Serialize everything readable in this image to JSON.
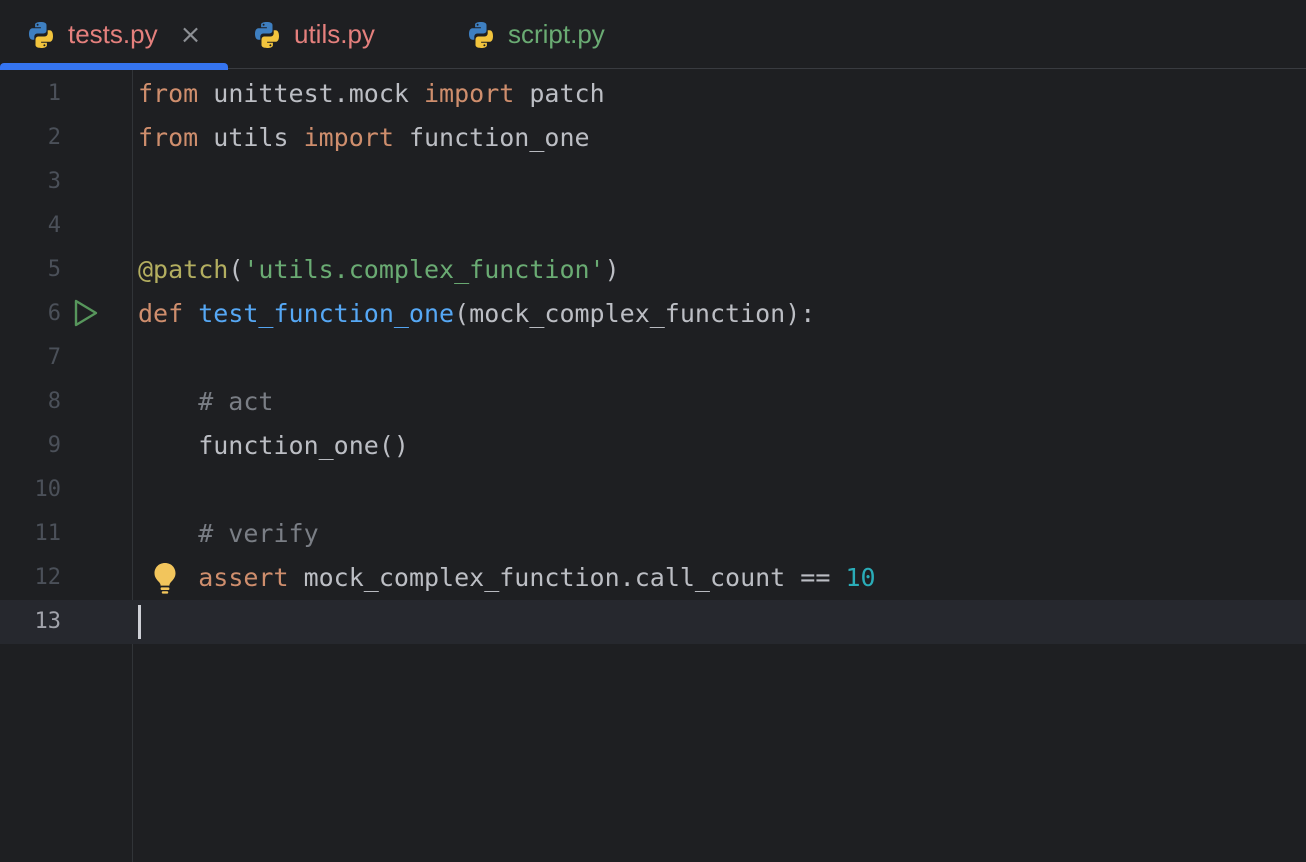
{
  "tabs": [
    {
      "label": "tests.py",
      "color": "#e5807d",
      "active": true,
      "closable": true,
      "close_glyph": "×"
    },
    {
      "label": "utils.py",
      "color": "#e5807d",
      "active": false
    },
    {
      "label": "script.py",
      "color": "#6aab73",
      "active": false
    }
  ],
  "accent_color": "#3574f0",
  "editor": {
    "line_numbers": [
      "1",
      "2",
      "3",
      "4",
      "5",
      "6",
      "7",
      "8",
      "9",
      "10",
      "11",
      "12",
      "13"
    ],
    "current_line": "13",
    "lines": {
      "l1": {
        "from": "from",
        "module": " unittest.mock ",
        "import": "import",
        "name": " patch"
      },
      "l2": {
        "from": "from",
        "module": " utils ",
        "import": "import",
        "name": " function_one"
      },
      "l5": {
        "decorator": "@patch",
        "open": "(",
        "string": "'utils.complex_function'",
        "close": ")"
      },
      "l6": {
        "def": "def",
        "space": " ",
        "fn_name": "test_function_one",
        "params": "(mock_complex_function):"
      },
      "l8": {
        "comment": "    # act"
      },
      "l9": {
        "code": "    function_one()"
      },
      "l11": {
        "comment": "    # verify"
      },
      "l12": {
        "indent": "    ",
        "assert": "assert",
        "expr": " mock_complex_function.call_count == ",
        "number": "10"
      }
    },
    "gutter_icons": {
      "run": "run-test-icon",
      "bulb": "lightbulb-icon"
    }
  }
}
